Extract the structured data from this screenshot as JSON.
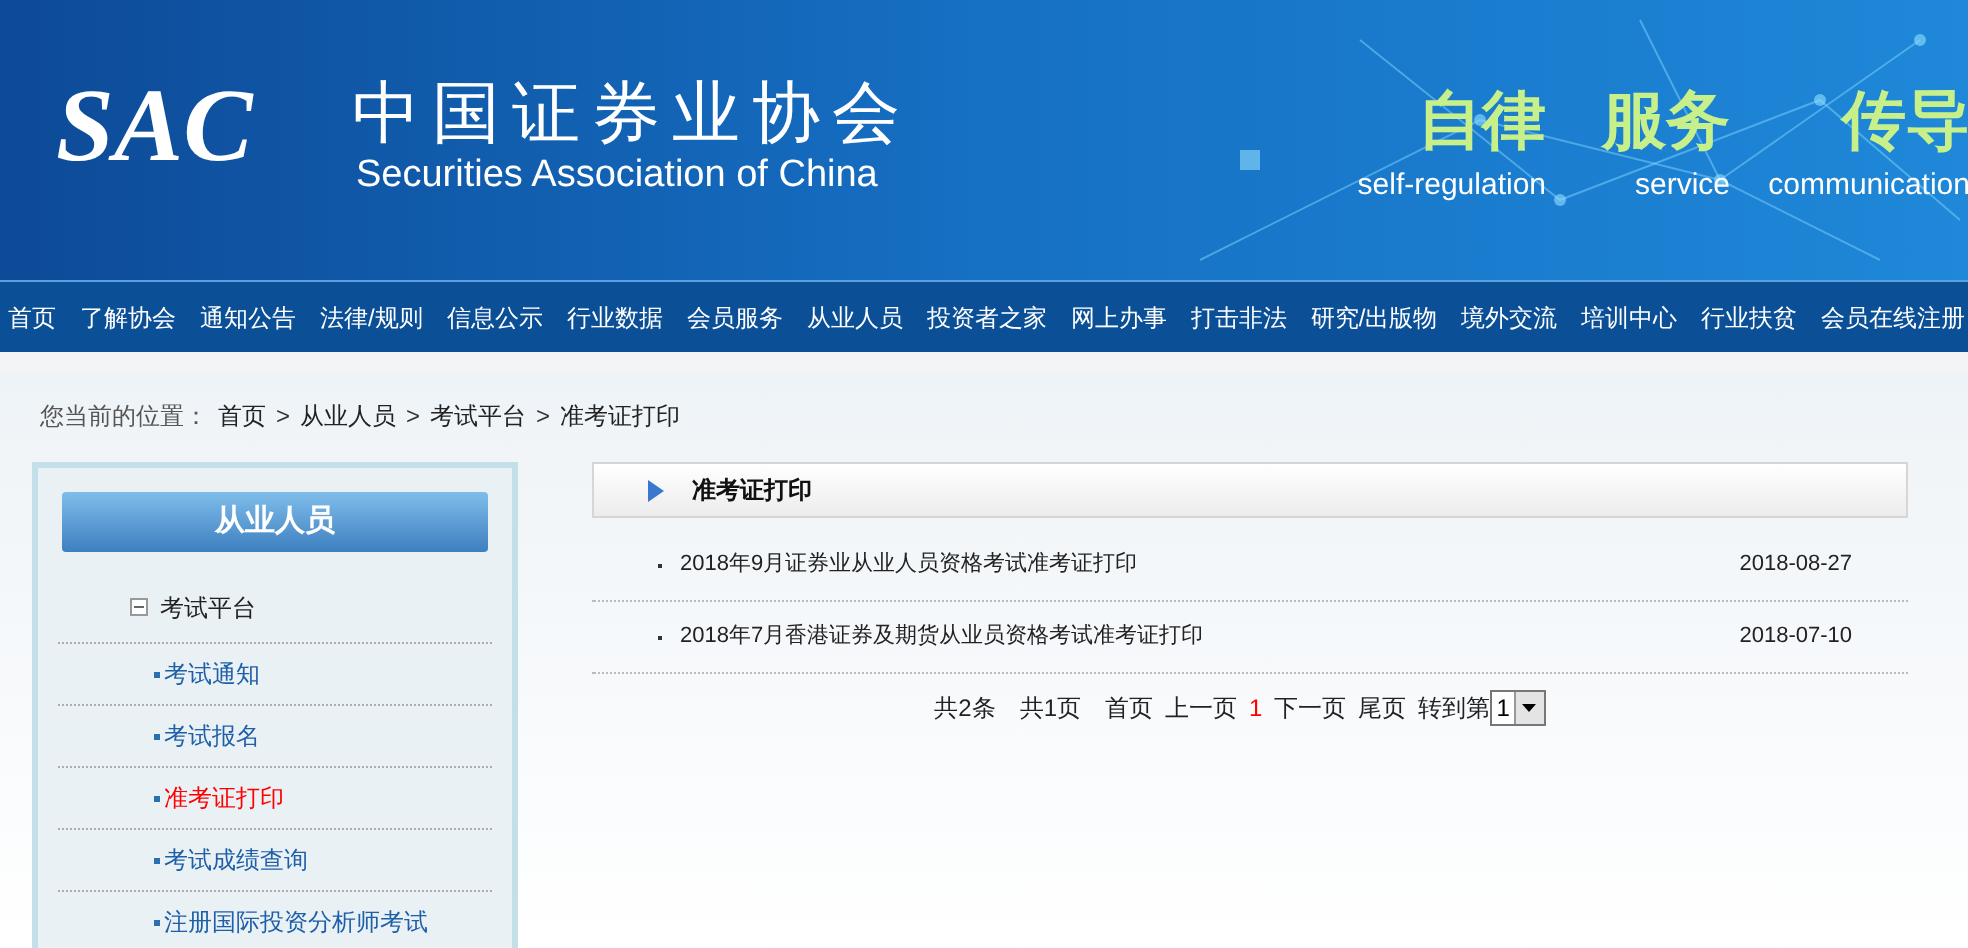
{
  "header": {
    "logo": "SAC",
    "name_cn": "中国证券业协会",
    "name_en": "Securities Association of China",
    "slogans": [
      {
        "cn": "自律",
        "en": "self-regulation"
      },
      {
        "cn": "服务",
        "en": "service"
      },
      {
        "cn": "传导",
        "en": "communication"
      }
    ]
  },
  "nav": [
    "首页",
    "了解协会",
    "通知公告",
    "法律/规则",
    "信息公示",
    "行业数据",
    "会员服务",
    "从业人员",
    "投资者之家",
    "网上办事",
    "打击非法",
    "研究/出版物",
    "境外交流",
    "培训中心",
    "行业扶贫",
    "会员在线注册"
  ],
  "breadcrumb": {
    "label": "您当前的位置：",
    "items": [
      "首页",
      "从业人员",
      "考试平台",
      "准考证打印"
    ],
    "separator": ">"
  },
  "sidebar": {
    "title": "从业人员",
    "tree": [
      {
        "label": "考试平台",
        "expanded": true,
        "children": [
          {
            "label": "考试通知",
            "selected": false
          },
          {
            "label": "考试报名",
            "selected": false
          },
          {
            "label": "准考证打印",
            "selected": true
          },
          {
            "label": "考试成绩查询",
            "selected": false
          },
          {
            "label": "注册国际投资分析师考试",
            "selected": false
          }
        ]
      }
    ]
  },
  "content": {
    "title": "准考证打印",
    "rows": [
      {
        "title": "2018年9月证券业从业人员资格考试准考证打印",
        "date": "2018-08-27"
      },
      {
        "title": "2018年7月香港证券及期货从业员资格考试准考证打印",
        "date": "2018-07-10"
      }
    ],
    "pagination": {
      "total_items": "共2条",
      "total_pages": "共1页",
      "first": "首页",
      "prev": "上一页",
      "pages": [
        {
          "label": "1",
          "selected": true
        }
      ],
      "next": "下一页",
      "last": "尾页",
      "goto": "转到第",
      "page_select": "1"
    }
  }
}
